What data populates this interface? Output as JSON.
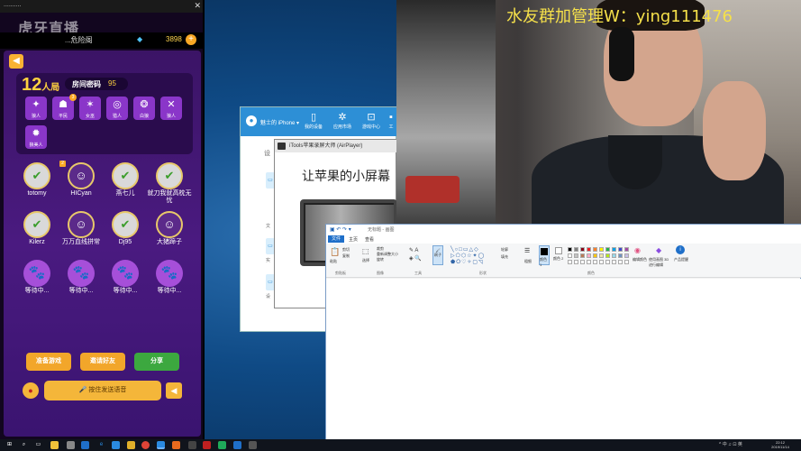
{
  "stream": {
    "watermark": "虎牙直播",
    "caption": "水友群加管理W：ying111476"
  },
  "game": {
    "status_text": "..........",
    "room_name": "...危险阁",
    "gem_icon": "diamond-icon",
    "coins": "3898",
    "add": "+",
    "players": "12",
    "players_unit": "人局",
    "room_code_label": "房间密码",
    "room_code": "95",
    "roles": [
      {
        "label": "狼人",
        "icon": "wolf-icon"
      },
      {
        "label": "平民",
        "icon": "villager-icon",
        "badge": "3"
      },
      {
        "label": "女巫",
        "icon": "witch-icon"
      },
      {
        "label": "猎人",
        "icon": "hunter-icon"
      },
      {
        "label": "白狼",
        "icon": "white-wolf-icon"
      },
      {
        "label": "狼人",
        "icon": "wolf-mask-icon"
      },
      {
        "label": "狼美人",
        "icon": "wolf-beauty-icon"
      }
    ],
    "seats": [
      {
        "name": "totomy",
        "ready": true
      },
      {
        "name": "HICyan",
        "ready": false,
        "idx": "2"
      },
      {
        "name": "燕七儿",
        "ready": true
      },
      {
        "name": "就刀我就高枕无忧",
        "ready": true
      },
      {
        "name": "Kilerz",
        "ready": true
      },
      {
        "name": "万万血线拼常",
        "ready": false
      },
      {
        "name": "Dj95",
        "ready": true
      },
      {
        "name": "大猪蹄子",
        "ready": false
      },
      {
        "name": "等待中...",
        "waiting": true
      },
      {
        "name": "等待中...",
        "waiting": true
      },
      {
        "name": "等待中...",
        "waiting": true
      },
      {
        "name": "等待中...",
        "waiting": true
      }
    ],
    "ready_button": "准备游戏",
    "invite_button": "邀请好友",
    "share_button": "分享",
    "voice_button": "按住发送语音"
  },
  "itools": {
    "device": "魅士的 iPhone ▾",
    "tabs": [
      "我的设备",
      "应用市场",
      "游戏中心",
      "工"
    ],
    "side_labels": [
      "设",
      "文",
      "实",
      "设"
    ]
  },
  "airplayer": {
    "title": "iTools苹果录屏大师 (AirPlayer)",
    "headline": "让苹果的小屏幕"
  },
  "paint": {
    "title": "无标题 - 画图",
    "tabs": [
      "文件",
      "主页",
      "查看"
    ],
    "groups": [
      "剪贴板",
      "图像",
      "工具",
      "形状",
      "颜色"
    ],
    "buttons": {
      "paste": "粘贴",
      "cut": "剪切",
      "copy": "复制",
      "select": "选择",
      "crop": "裁剪",
      "resize": "重新调整大小",
      "rotate": "旋转",
      "brush": "刷子",
      "outline": "轮廓",
      "fill": "填充",
      "size": "粗细",
      "color1": "颜色 1",
      "color2": "颜色 2",
      "edit_colors": "编辑颜色",
      "paint3d": "使用画图 3D 进行编辑",
      "product_alert": "产品提醒"
    },
    "palette": [
      "#000000",
      "#7f7f7f",
      "#880015",
      "#ed1c24",
      "#ff7f27",
      "#fff200",
      "#22b14c",
      "#00a2e8",
      "#3f48cc",
      "#a349a4",
      "#ffffff",
      "#c3c3c3",
      "#b97a57",
      "#ffaec9",
      "#ffc90e",
      "#efe4b0",
      "#b5e61d",
      "#99d9ea",
      "#7092be",
      "#c8bfe7"
    ]
  },
  "taskbar": {
    "tray": "^ 中 ♫ ⊡ 英",
    "time": "22:12",
    "date": "2019/11/14"
  }
}
